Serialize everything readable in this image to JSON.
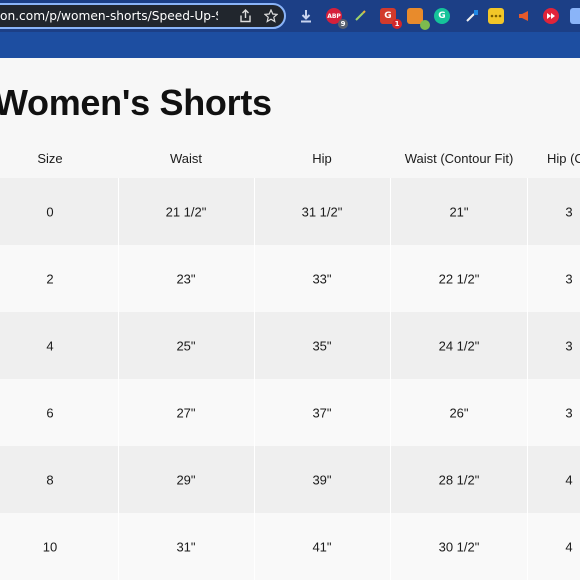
{
  "browser": {
    "url": "on.com/p/women-shorts/Speed-Up-Shorts",
    "extensions": [
      {
        "name": "download-icon",
        "badge": ""
      },
      {
        "name": "adblock-icon",
        "label": "ABP",
        "badge": "9"
      },
      {
        "name": "pen-icon",
        "badge": ""
      },
      {
        "name": "g-extension-icon",
        "label": "G",
        "badge": "1"
      },
      {
        "name": "puzzle-icon",
        "badge": ""
      },
      {
        "name": "grammarly-icon",
        "label": "G",
        "badge": ""
      },
      {
        "name": "eyedropper-icon",
        "badge": ""
      },
      {
        "name": "menu-dots-icon",
        "badge": ""
      },
      {
        "name": "megaphone-icon",
        "badge": ""
      },
      {
        "name": "forward-icon",
        "badge": ""
      },
      {
        "name": "extension-icon",
        "badge": ""
      }
    ]
  },
  "page": {
    "title": "Women's Shorts"
  },
  "table": {
    "headers": [
      "Size",
      "Waist",
      "Hip",
      "Waist (Contour Fit)",
      "Hip (Co"
    ],
    "rows": [
      [
        "0",
        "21 1/2\"",
        "31 1/2\"",
        "21\"",
        "3"
      ],
      [
        "2",
        "23\"",
        "33\"",
        "22 1/2\"",
        "3"
      ],
      [
        "4",
        "25\"",
        "35\"",
        "24 1/2\"",
        "3"
      ],
      [
        "6",
        "27\"",
        "37\"",
        "26\"",
        "3"
      ],
      [
        "8",
        "29\"",
        "39\"",
        "28 1/2\"",
        "4"
      ],
      [
        "10",
        "31\"",
        "41\"",
        "30 1/2\"",
        "4"
      ]
    ]
  },
  "colors": {
    "chrome_bar": "#1c3f86",
    "nav_strip": "#1d4ea1",
    "row_shaded": "#efefef",
    "row_plain": "#f9f9f9"
  }
}
